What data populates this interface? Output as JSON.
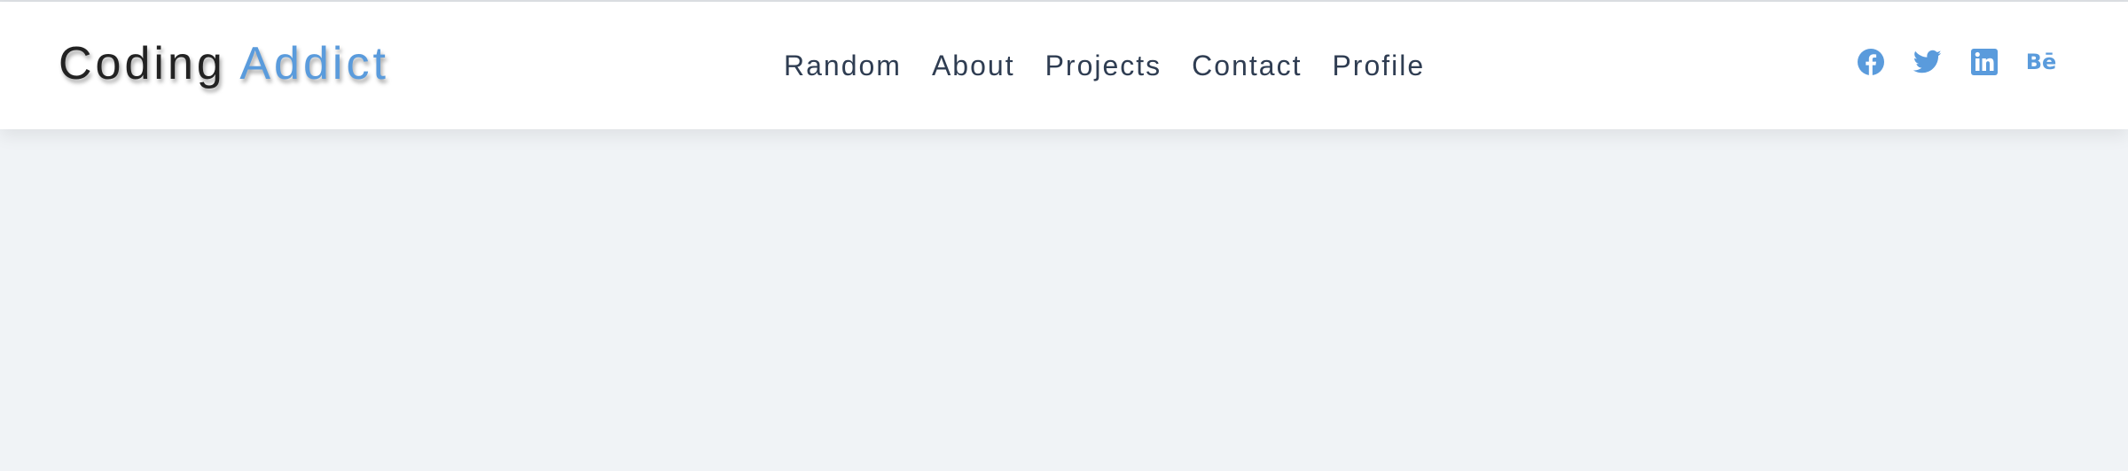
{
  "header": {
    "logo": {
      "part1": "Coding",
      "part2": "Addict"
    },
    "nav": [
      {
        "label": "Random"
      },
      {
        "label": "About"
      },
      {
        "label": "Projects"
      },
      {
        "label": "Contact"
      },
      {
        "label": "Profile"
      }
    ],
    "social": [
      {
        "icon": "facebook-icon"
      },
      {
        "icon": "twitter-icon"
      },
      {
        "icon": "linkedin-icon"
      },
      {
        "icon": "behance-icon",
        "text": "Bē"
      }
    ]
  },
  "colors": {
    "accent": "#5a9bdc",
    "nav_text": "#2f3d52",
    "logo_text": "#222222",
    "page_background": "#f0f3f6",
    "header_background": "#ffffff"
  }
}
